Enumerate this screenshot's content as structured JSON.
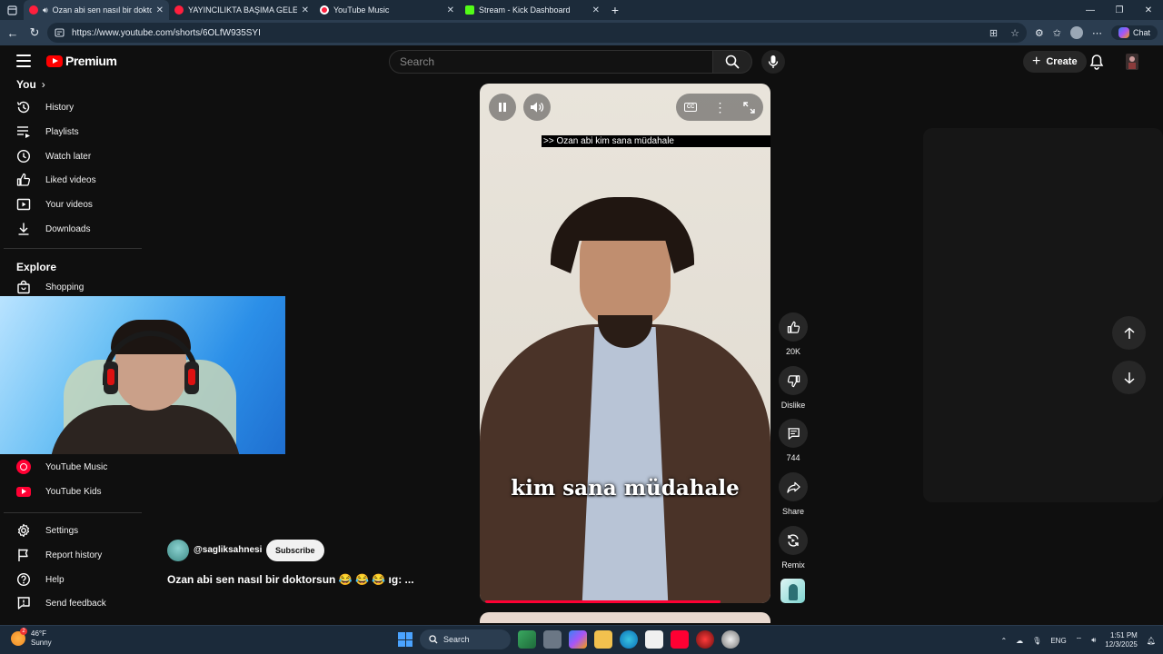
{
  "browser": {
    "tabs": [
      {
        "title": "Ozan abi sen nasıl bir dokto",
        "favicon": "youtube-icon",
        "active": true,
        "audio": true
      },
      {
        "title": "YAYINCILIKTA BAŞIMA GELENLER",
        "favicon": "youtube-icon",
        "active": false
      },
      {
        "title": "YouTube Music",
        "favicon": "youtube-music-icon",
        "active": false
      },
      {
        "title": "Stream - Kick Dashboard",
        "favicon": "kick-icon",
        "active": false
      }
    ],
    "url": "https://www.youtube.com/shorts/6OLfW935SYI",
    "chat_label": "Chat"
  },
  "header": {
    "logo_text": "Premium",
    "search_placeholder": "Search",
    "create_label": "Create"
  },
  "sidebar": {
    "you_label": "You",
    "you_items": [
      {
        "label": "History",
        "icon": "history-icon"
      },
      {
        "label": "Playlists",
        "icon": "playlists-icon"
      },
      {
        "label": "Watch later",
        "icon": "watch-later-icon"
      },
      {
        "label": "Liked videos",
        "icon": "thumbs-up-icon"
      },
      {
        "label": "Your videos",
        "icon": "your-videos-icon"
      },
      {
        "label": "Downloads",
        "icon": "download-icon"
      }
    ],
    "explore_label": "Explore",
    "explore_items": [
      {
        "label": "Shopping",
        "icon": "shopping-bag-icon"
      }
    ],
    "more_items": [
      {
        "label": "YouTube Music",
        "icon": "youtube-music-icon"
      },
      {
        "label": "YouTube Kids",
        "icon": "youtube-kids-icon"
      }
    ],
    "footer_items": [
      {
        "label": "Settings",
        "icon": "gear-icon"
      },
      {
        "label": "Report history",
        "icon": "flag-icon"
      },
      {
        "label": "Help",
        "icon": "help-icon"
      },
      {
        "label": "Send feedback",
        "icon": "feedback-icon"
      }
    ]
  },
  "video": {
    "caption_top": ">> Ozan abi kim sana müdahale",
    "subtitle": "kim sana müdahale",
    "progress": 0.84,
    "accent": "#ff0033"
  },
  "channel": {
    "handle": "@sagliksahnesi",
    "subscribe_label": "Subscribe",
    "title": "Ozan abi sen nasıl bir doktorsun 😂 😂 😂 ıg: ..."
  },
  "actions": {
    "likes": "20K",
    "dislike": "Dislike",
    "comments": "744",
    "share": "Share",
    "remix": "Remix"
  },
  "taskbar": {
    "weather_temp": "46°F",
    "weather_cond": "Sunny",
    "weather_badge": "2",
    "search_label": "Search",
    "lang": "ENG",
    "time": "1:51 PM",
    "date": "12/3/2025"
  }
}
